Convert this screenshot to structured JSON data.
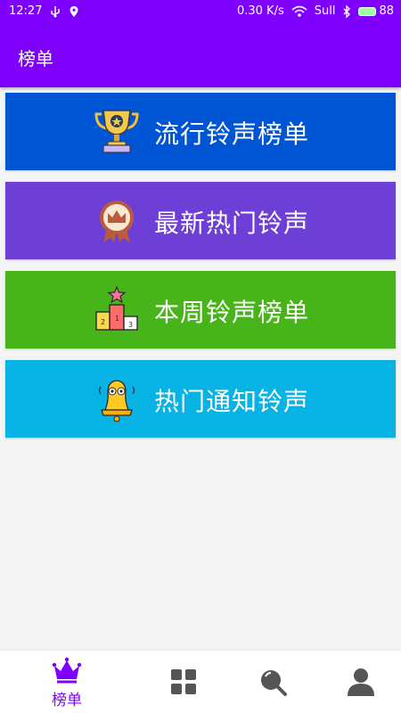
{
  "status_bar": {
    "time": "12:27",
    "network_speed": "0.30 K/s",
    "carrier_signal": "Sull",
    "battery_level": "88"
  },
  "app_bar": {
    "title": "榜单"
  },
  "categories": [
    {
      "label": "流行铃声榜单",
      "icon": "trophy-icon",
      "color": "#0055d4"
    },
    {
      "label": "最新热门铃声",
      "icon": "crown-medal-icon",
      "color": "#6e3fd7"
    },
    {
      "label": "本周铃声榜单",
      "icon": "podium-icon",
      "color": "#47b41a"
    },
    {
      "label": "热门通知铃声",
      "icon": "bell-icon",
      "color": "#07b2e4"
    }
  ],
  "tab_bar": {
    "active_color": "#8000ff",
    "inactive_color": "#555555",
    "tabs": [
      {
        "label": "榜单",
        "icon": "crown-icon",
        "active": true
      },
      {
        "label": "",
        "icon": "grid-icon",
        "active": false
      },
      {
        "label": "",
        "icon": "search-icon",
        "active": false
      },
      {
        "label": "",
        "icon": "user-icon",
        "active": false
      }
    ]
  }
}
